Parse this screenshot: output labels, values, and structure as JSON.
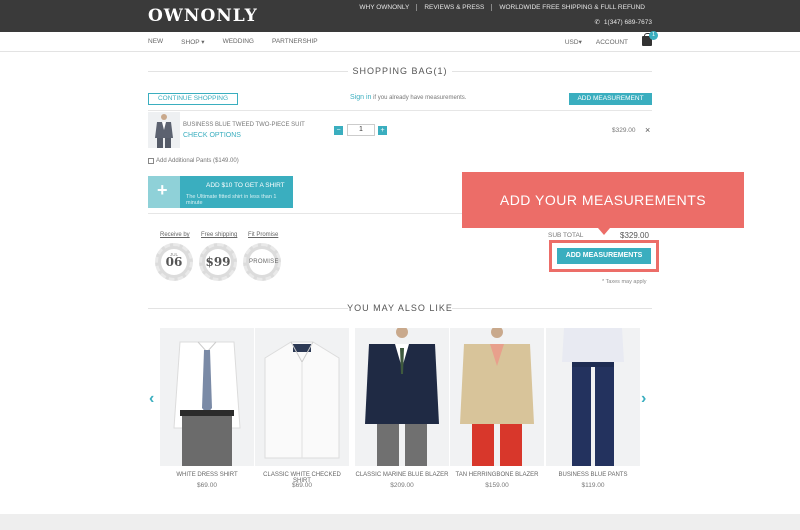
{
  "header": {
    "logo": "OWNONLY",
    "links": [
      "WHY OWNONLY",
      "REVIEWS & PRESS",
      "WORLDWIDE FREE SHIPPING & FULL REFUND"
    ],
    "phone": "1(347) 689-7673"
  },
  "nav": {
    "items": [
      "NEW",
      "SHOP",
      "WEDDING",
      "PARTNERSHIP"
    ],
    "currency": "USD",
    "account": "ACCOUNT",
    "bag_count": "1"
  },
  "bag": {
    "title": "SHOPPING BAG(1)",
    "continue_label": "CONTINUE SHOPPING",
    "signin_link": "Sign in",
    "signin_rest": " if you already have measurements.",
    "add_measurement_label": "ADD MEASUREMENT",
    "item": {
      "name": "BUSINESS BLUE TWEED TWO-PIECE SUIT",
      "check_options": "CHECK OPTIONS",
      "qty": "1",
      "minus": "−",
      "plus": "+",
      "price": "$329.00",
      "remove": "×"
    },
    "add_pants": "Add Additional Pants ($149.00)",
    "shirt_banner": {
      "title": "ADD $10 TO GET A SHIRT",
      "subtitle": "The Ultimate fitted shirt in less than 1 minute",
      "plus": "+"
    }
  },
  "badges": [
    {
      "label": "Receive by",
      "top": "JUL",
      "big": "06"
    },
    {
      "label": "Free shipping",
      "top": "",
      "big": "$99"
    },
    {
      "label": "Fit Promise",
      "top": "",
      "big": "PROMISE"
    }
  ],
  "summary": {
    "subtotal_label": "SUB TOTAL",
    "subtotal_value": "$329.00",
    "add_measurements_label": "ADD MEASUREMENTS",
    "taxes_note": "* Taxes may apply"
  },
  "callout": {
    "text": "ADD YOUR MEASUREMENTS",
    "color": "#ec6d68"
  },
  "recommend": {
    "title": "YOU MAY ALSO LIKE",
    "prev": "‹",
    "next": "›",
    "products": [
      {
        "name": "WHITE DRESS SHIRT",
        "price": "$69.00"
      },
      {
        "name": "CLASSIC WHITE CHECKED SHIRT",
        "price": "$69.00"
      },
      {
        "name": "CLASSIC MARINE BLUE BLAZER",
        "price": "$209.00"
      },
      {
        "name": "TAN HERRINGBONE BLAZER",
        "price": "$159.00"
      },
      {
        "name": "BUSINESS BLUE PANTS",
        "price": "$119.00"
      }
    ]
  },
  "colors": {
    "accent": "#3aaebf",
    "header_bg": "#3a3a3a",
    "callout": "#ec6d68"
  }
}
